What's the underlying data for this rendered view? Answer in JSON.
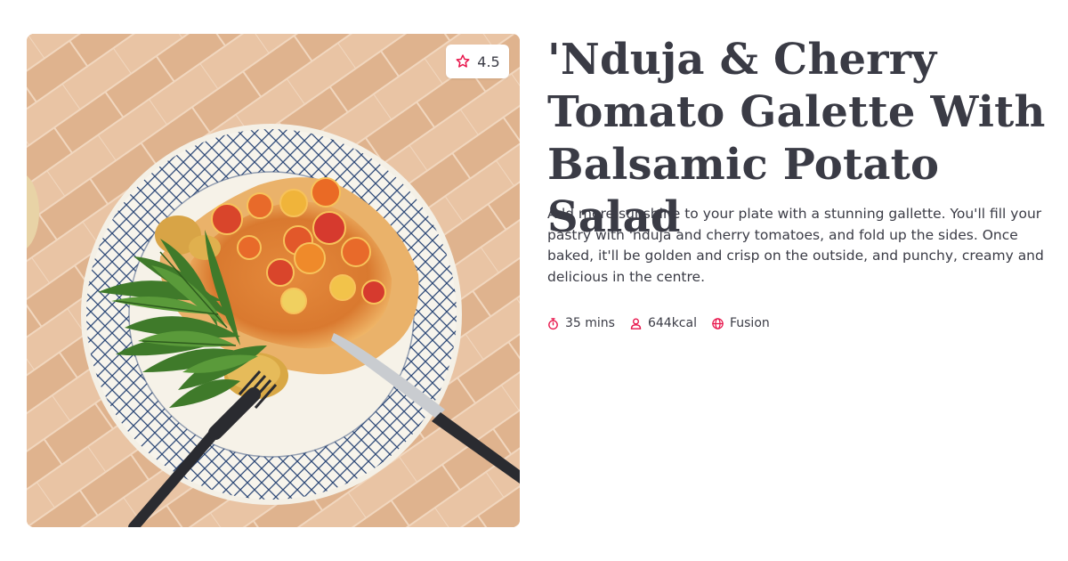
{
  "recipe": {
    "title": "'Nduja & Cherry Tomato Galette With Balsamic Potato Salad",
    "description": "Add more sunshine to your plate with a stunning gallette. You'll fill your pastry with 'nduja and cherry tomatoes, and fold up the sides. Once baked, it'll be golden and crisp on the outside, and punchy, creamy and delicious in the centre.",
    "rating": "4.5",
    "meta": {
      "time": "35 mins",
      "calories": "644kcal",
      "cuisine": "Fusion"
    },
    "icons": {
      "rating": "star-icon",
      "time": "timer-icon",
      "calories": "person-icon",
      "cuisine": "globe-icon"
    }
  },
  "colors": {
    "accent": "#e8164c",
    "text": "#3a3b45"
  }
}
